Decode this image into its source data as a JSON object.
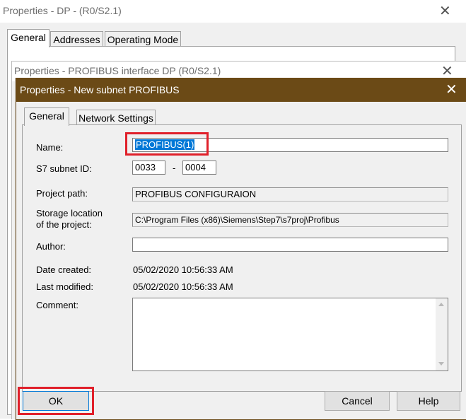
{
  "window_back": {
    "title": "Properties - DP - (R0/S2.1)",
    "tabs": [
      "General",
      "Addresses",
      "Operating Mode"
    ]
  },
  "window_middle": {
    "title": "Properties - PROFIBUS interface  DP (R0/S2.1)"
  },
  "dialog": {
    "title": "Properties -  New subnet PROFIBUS",
    "tabs": [
      "General",
      "Network Settings"
    ],
    "labels": {
      "name": "Name:",
      "subnet_id": "S7 subnet ID:",
      "subnet_dash": "-",
      "project_path": "Project path:",
      "storage_line1": "Storage location",
      "storage_line2": "of the project:",
      "author": "Author:",
      "date_created": "Date created:",
      "last_modified": "Last modified:",
      "comment": "Comment:"
    },
    "values": {
      "name": "PROFIBUS(1)",
      "subnet_id_1": "0033",
      "subnet_id_2": "0004",
      "project_path": "PROFIBUS CONFIGURAION",
      "storage_location": "C:\\Program Files (x86)\\Siemens\\Step7\\s7proj\\Profibus",
      "author": "",
      "date_created": "05/02/2020 10:56:33 AM",
      "last_modified": "05/02/2020 10:56:33 AM",
      "comment": ""
    },
    "buttons": {
      "ok": "OK",
      "cancel": "Cancel",
      "help": "Help"
    }
  },
  "colors": {
    "dialog_titlebar": "#6b4a16",
    "highlight": "#e0202a",
    "selection": "#0078d7"
  }
}
